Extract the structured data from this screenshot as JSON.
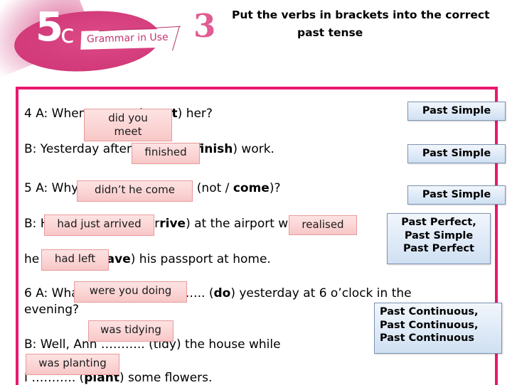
{
  "logo": {
    "unit": "5",
    "section": "c",
    "tagline": "Grammar in Use"
  },
  "header": {
    "exercise_number": "3",
    "instruction_line1": "Put the verbs in brackets into the correct",
    "instruction_line2": "past tense"
  },
  "colors": {
    "frame_pink": "#e8186e",
    "logo_pink": "#d43d7c",
    "answer_fill": "#fbd4d4",
    "answer_border": "#e89a9a",
    "tense_fill": "#e2ecf8",
    "tense_border": "#7d93b3"
  },
  "exercise_lines": [
    {
      "id": "line-4a",
      "text_before": "4 A: When ……….. (",
      "verb": "meet",
      "text_after": ") her?"
    },
    {
      "id": "line-4b",
      "text_before": "B: Yesterday after I ……….. (",
      "verb": "finish",
      "text_after": ") work."
    },
    {
      "id": "line-5a",
      "text_before": "5 A: Why ……….. he ……….. (not / ",
      "verb": "come",
      "text_after": ")?"
    },
    {
      "id": "line-5b",
      "text_before": "B: He ……….. (just / ar",
      "verb": "rive",
      "text_after": ") at the airport when he …."
    },
    {
      "id": "line-5c",
      "text_before": "he ……….. (le",
      "verb": "ave",
      "text_after": ") his passport at home."
    },
    {
      "id": "line-6a",
      "text_before": "6 A: What ……….. you ……….. (",
      "verb": "do",
      "text_after": ") yesterday at 6 o’clock in the"
    },
    {
      "id": "line-6a-cont",
      "text_before": "evening?",
      "verb": "",
      "text_after": ""
    },
    {
      "id": "line-6b",
      "text_before": "B: Well, Ann ……….. (tidy) the house while",
      "verb": "",
      "text_after": ""
    },
    {
      "id": "line-6c",
      "text_before": "I ……….. (",
      "verb": "plant",
      "text_after": ") some flowers."
    }
  ],
  "answers": [
    {
      "id": "answer-did-you-meet",
      "label": "did you\nmeet"
    },
    {
      "id": "answer-finished",
      "label": "finished"
    },
    {
      "id": "answer-didnt-he-come",
      "label": "didn’t he come"
    },
    {
      "id": "answer-had-just-arrived",
      "label": "had just arrived"
    },
    {
      "id": "answer-realised",
      "label": "realised"
    },
    {
      "id": "answer-had-left",
      "label": "had left"
    },
    {
      "id": "answer-were-you-doing",
      "label": "were you doing"
    },
    {
      "id": "answer-was-tidying",
      "label": "was tidying"
    },
    {
      "id": "answer-was-planting",
      "label": "was planting"
    }
  ],
  "tense_labels": [
    {
      "id": "tense-1",
      "label": "Past Simple"
    },
    {
      "id": "tense-2",
      "label": "Past Simple"
    },
    {
      "id": "tense-3",
      "label": "Past Simple"
    },
    {
      "id": "tense-4",
      "label": "Past Perfect,\nPast Simple\nPast Perfect"
    },
    {
      "id": "tense-5",
      "label": "Past Continuous,\nPast Continuous,\nPast Continuous"
    }
  ]
}
